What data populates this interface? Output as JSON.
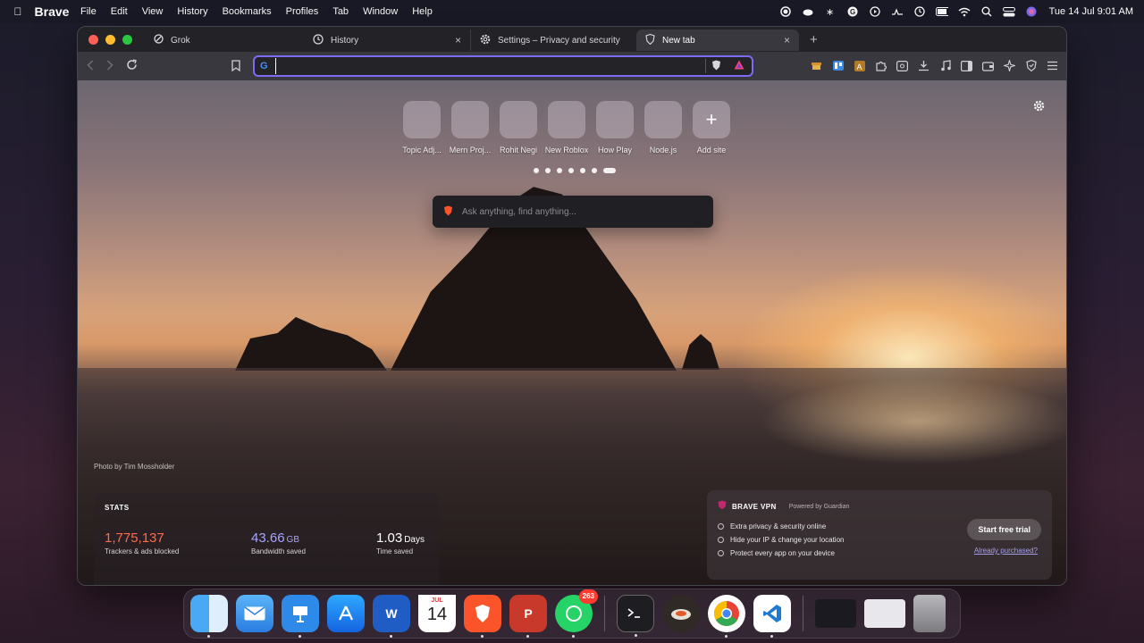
{
  "menubar": {
    "app": "Brave",
    "items": [
      "File",
      "Edit",
      "View",
      "History",
      "Bookmarks",
      "Profiles",
      "Tab",
      "Window",
      "Help"
    ],
    "clock": "Tue 14 Jul  9:01 AM"
  },
  "tabs": [
    {
      "title": "Grok",
      "active": false
    },
    {
      "title": "History",
      "active": false
    },
    {
      "title": "Settings – Privacy and security",
      "active": false
    },
    {
      "title": "New tab",
      "active": true
    }
  ],
  "address_bar": {
    "value": "",
    "search_engine_icon": "G"
  },
  "ntp": {
    "top_sites": [
      "Topic Adj...",
      "Mern Proj...",
      "Rohit Negi",
      "New Roblox",
      "How Play",
      "Node.js"
    ],
    "add_site_label": "Add site",
    "pager_pages": 7,
    "pager_active": 6,
    "search_placeholder": "Ask anything, find anything...",
    "photo_credit": "Photo by Tim Mossholder"
  },
  "stats": {
    "heading": "STATS",
    "trackers": {
      "value": "1,775,137",
      "label": "Trackers & ads blocked"
    },
    "bandwidth": {
      "value": "43.66",
      "unit": "GB",
      "label": "Bandwidth saved"
    },
    "time": {
      "value": "1.03",
      "unit": "Days",
      "label": "Time saved"
    }
  },
  "vpn": {
    "title": "BRAVE VPN",
    "powered_by": "Powered by Guardian",
    "features": [
      "Extra privacy & security online",
      "Hide your IP & change your location",
      "Protect every app on your device"
    ],
    "cta": "Start free trial",
    "already": "Already purchased?"
  },
  "dock": {
    "calendar_month": "JUL",
    "calendar_day": "14",
    "whatsapp_badge": "263"
  },
  "colors": {
    "accent": "#7b6cf2",
    "trackers": "#ff6a4d",
    "bandwidth": "#a7a4ff"
  }
}
